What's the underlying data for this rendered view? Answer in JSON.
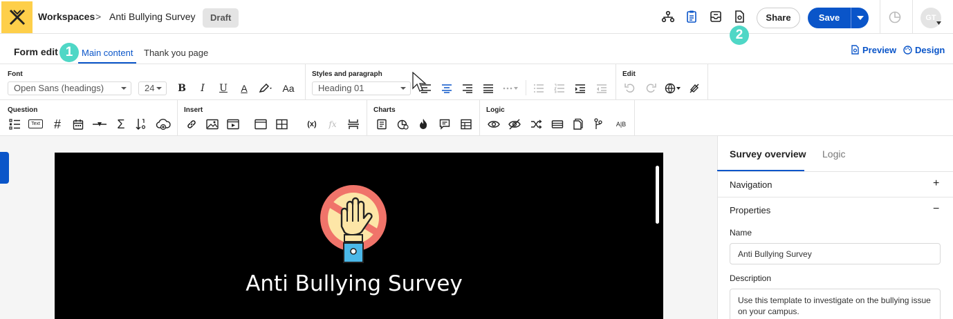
{
  "header": {
    "breadcrumb_root": "Workspaces",
    "breadcrumb_sep": ">",
    "form_name": "Anti Bullying Survey",
    "status": "Draft",
    "share_label": "Share",
    "save_label": "Save",
    "avatar_initials": "GT",
    "step_badge": "2"
  },
  "subnav": {
    "title": "Form edit",
    "step_badge": "1",
    "tabs": [
      "Main content",
      "Thank you page"
    ],
    "active_tab": "Main content",
    "preview_label": "Preview",
    "design_label": "Design"
  },
  "ribbon": {
    "font_group": "Font",
    "font_family": "Open Sans (headings)",
    "font_size": "24",
    "styles_group": "Styles and paragraph",
    "style_value": "Heading 01",
    "edit_group": "Edit",
    "question_group": "Question",
    "insert_group": "Insert",
    "charts_group": "Charts",
    "logic_group": "Logic",
    "bold": "B",
    "italic": "I",
    "underline": "U",
    "text_color": "A",
    "case": "Aa",
    "hash": "#",
    "sum": "Σ",
    "variable": "(x)",
    "fx": "fx",
    "ab": "A|B",
    "text_icon": "Text"
  },
  "canvas": {
    "title": "Anti Bullying Survey"
  },
  "right_panel": {
    "tabs": [
      "Survey overview",
      "Logic"
    ],
    "navigation_label": "Navigation",
    "navigation_toggle": "+",
    "properties_label": "Properties",
    "properties_toggle": "−",
    "name_label": "Name",
    "name_value": "Anti Bullying Survey",
    "description_label": "Description",
    "description_value": "Use this template to investigate on the bullying issue on your campus."
  },
  "colors": {
    "accent": "#0a55c9",
    "logo_bg": "#fecf4a",
    "badge": "#4fd7c6"
  }
}
